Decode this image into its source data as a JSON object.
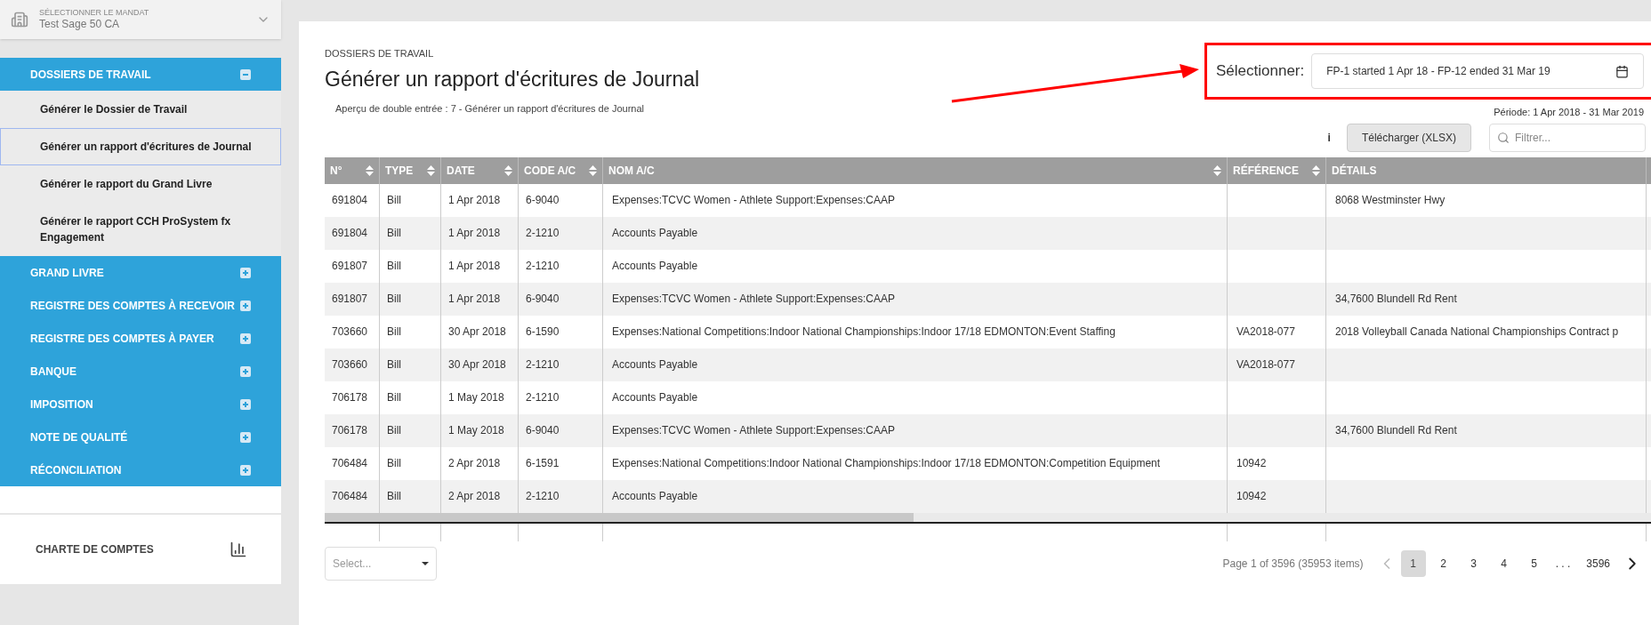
{
  "mandate": {
    "label": "SÉLECTIONNER LE MANDAT",
    "value": "Test Sage 50 CA"
  },
  "sidebar": {
    "sections": [
      {
        "label": "DOSSIERS DE TRAVAIL",
        "expanded": true,
        "children": [
          {
            "label": "Générer le Dossier de Travail",
            "selected": false
          },
          {
            "label": "Générer un rapport d'écritures de Journal",
            "selected": true
          },
          {
            "label": "Générer le rapport du Grand Livre",
            "selected": false
          },
          {
            "label": "Générer le rapport CCH ProSystem fx Engagement",
            "selected": false
          }
        ]
      },
      {
        "label": "GRAND LIVRE",
        "expanded": false
      },
      {
        "label": "REGISTRE DES COMPTES À RECEVOIR",
        "expanded": false
      },
      {
        "label": "REGISTRE DES COMPTES À PAYER",
        "expanded": false
      },
      {
        "label": "BANQUE",
        "expanded": false
      },
      {
        "label": "IMPOSITION",
        "expanded": false
      },
      {
        "label": "NOTE DE QUALITÉ",
        "expanded": false
      },
      {
        "label": "RÉCONCILIATION",
        "expanded": false
      }
    ],
    "footer": "CHARTE DE COMPTES"
  },
  "page": {
    "breadcrumb": "DOSSIERS DE TRAVAIL",
    "title": "Générer un rapport d'écritures de Journal",
    "subtitle": "Aperçu de double entrée : 7 - Générer un rapport d'écritures de Journal",
    "period": "Période: 1 Apr 2018 - 31 Mar 2019",
    "selector": {
      "label": "Sélectionner:",
      "value": "FP-1 started 1 Apr 18 - FP-12 ended 31 Mar 19"
    },
    "info": "i",
    "download": "Télécharger (XLSX)",
    "filter": {
      "placeholder": "Filtrer..."
    }
  },
  "table": {
    "columns": [
      {
        "label": "N°",
        "sortable": true
      },
      {
        "label": "TYPE",
        "sortable": true
      },
      {
        "label": "DATE",
        "sortable": true
      },
      {
        "label": "CODE A/C",
        "sortable": true
      },
      {
        "label": "NOM A/C",
        "sortable": true
      },
      {
        "label": "RÉFÉRENCE",
        "sortable": true
      },
      {
        "label": "DÉTAILS",
        "sortable": false
      }
    ],
    "rows": [
      [
        "691804",
        "Bill",
        "1 Apr 2018",
        "6-9040",
        "Expenses:TCVC Women - Athlete Support:Expenses:CAAP",
        "",
        "8068 Westminster Hwy"
      ],
      [
        "691804",
        "Bill",
        "1 Apr 2018",
        "2-1210",
        "Accounts Payable",
        "",
        ""
      ],
      [
        "691807",
        "Bill",
        "1 Apr 2018",
        "2-1210",
        "Accounts Payable",
        "",
        ""
      ],
      [
        "691807",
        "Bill",
        "1 Apr 2018",
        "6-9040",
        "Expenses:TCVC Women - Athlete Support:Expenses:CAAP",
        "",
        "34,7600 Blundell Rd Rent"
      ],
      [
        "703660",
        "Bill",
        "30 Apr 2018",
        "6-1590",
        "Expenses:National Competitions:Indoor National Championships:Indoor 17/18 EDMONTON:Event Staffing",
        "VA2018-077",
        "2018 Volleyball Canada National Championships Contract p"
      ],
      [
        "703660",
        "Bill",
        "30 Apr 2018",
        "2-1210",
        "Accounts Payable",
        "VA2018-077",
        ""
      ],
      [
        "706178",
        "Bill",
        "1 May 2018",
        "2-1210",
        "Accounts Payable",
        "",
        ""
      ],
      [
        "706178",
        "Bill",
        "1 May 2018",
        "6-9040",
        "Expenses:TCVC Women - Athlete Support:Expenses:CAAP",
        "",
        "34,7600 Blundell Rd Rent"
      ],
      [
        "706484",
        "Bill",
        "2 Apr 2018",
        "6-1591",
        "Expenses:National Competitions:Indoor National Championships:Indoor 17/18 EDMONTON:Competition Equipment",
        "10942",
        ""
      ],
      [
        "706484",
        "Bill",
        "2 Apr 2018",
        "2-1210",
        "Accounts Payable",
        "10942",
        ""
      ]
    ]
  },
  "pagination": {
    "page_size": {
      "placeholder": "Select..."
    },
    "summary": "Page 1 of 3596 (35953 items)",
    "pages": [
      {
        "label": "1",
        "selected": true
      },
      {
        "label": "2",
        "selected": false
      },
      {
        "label": "3",
        "selected": false
      },
      {
        "label": "4",
        "selected": false
      },
      {
        "label": "5",
        "selected": false
      }
    ],
    "ellipsis": ". . .",
    "last": "3596"
  }
}
